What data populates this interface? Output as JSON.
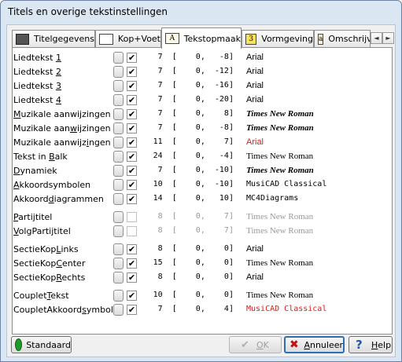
{
  "window": {
    "title": "Titels en overige tekstinstellingen"
  },
  "tabs": [
    {
      "label": "Titelgegevens",
      "icon": "image-icon"
    },
    {
      "label": "Kop+Voet",
      "icon": "page-icon"
    },
    {
      "label": "Tekstopmaak",
      "icon": "font-a-icon",
      "icon_text": "A",
      "active": true
    },
    {
      "label": "Vormgeving",
      "icon": "number-3-icon",
      "icon_text": "3"
    },
    {
      "label": "Omschrijving",
      "icon": "font-a-icon",
      "icon_text": "a"
    }
  ],
  "tab_scroll": {
    "left": "◄",
    "right": "►"
  },
  "rows": [
    {
      "pre": "Liedtekst ",
      "u": "1",
      "post": "",
      "checked": true,
      "v1": "7",
      "v2": "0",
      "v3": "-8",
      "font": "Arial",
      "style": "arial"
    },
    {
      "pre": "Liedtekst ",
      "u": "2",
      "post": "",
      "checked": true,
      "v1": "7",
      "v2": "0",
      "v3": "-12",
      "font": "Arial",
      "style": "arial"
    },
    {
      "pre": "Liedtekst ",
      "u": "3",
      "post": "",
      "checked": true,
      "v1": "7",
      "v2": "0",
      "v3": "-16",
      "font": "Arial",
      "style": "arial"
    },
    {
      "pre": "Liedtekst ",
      "u": "4",
      "post": "",
      "checked": true,
      "v1": "7",
      "v2": "0",
      "v3": "-20",
      "font": "Arial",
      "style": "arial"
    },
    {
      "pre": "",
      "u": "M",
      "post": "uzikale aanwijzingen 1",
      "checked": true,
      "v1": "7",
      "v2": "0",
      "v3": "8",
      "font": "Times New Roman",
      "style": "tnr-bi"
    },
    {
      "pre": "Muzikale aan",
      "u": "w",
      "post": "ijzingen 2",
      "checked": true,
      "v1": "7",
      "v2": "0",
      "v3": "-8",
      "font": "Times New Roman",
      "style": "tnr-bi"
    },
    {
      "pre": "Muzikale aanwijz",
      "u": "i",
      "post": "ngen 3",
      "checked": true,
      "v1": "11",
      "v2": "0",
      "v3": "7",
      "font": "Arial",
      "style": "arial-red"
    },
    {
      "pre": "Tekst in ",
      "u": "B",
      "post": "alk",
      "checked": true,
      "v1": "24",
      "v2": "0",
      "v3": "-4",
      "font": "Times New Roman",
      "style": "tnr"
    },
    {
      "pre": "",
      "u": "D",
      "post": "ynamiek",
      "checked": true,
      "v1": "7",
      "v2": "0",
      "v3": "-10",
      "font": "Times New Roman",
      "style": "tnr-bi"
    },
    {
      "pre": "",
      "u": "A",
      "post": "kkoordsymbolen",
      "checked": true,
      "v1": "10",
      "v2": "0",
      "v3": "-10",
      "font": "MusiCAD Classical",
      "style": "mono"
    },
    {
      "pre": "Akkoord",
      "u": "d",
      "post": "iagrammen",
      "checked": true,
      "v1": "14",
      "v2": "0",
      "v3": "10",
      "font": "MC4Diagrams",
      "style": "mono"
    },
    {
      "pre": "",
      "u": "P",
      "post": "artijtitel",
      "checked": false,
      "v1": "8",
      "v2": "0",
      "v3": "7",
      "font": "Times New Roman",
      "style": "tnr-grey",
      "gap": true
    },
    {
      "pre": "",
      "u": "V",
      "post": "olgPartijtitel",
      "checked": false,
      "v1": "8",
      "v2": "0",
      "v3": "7",
      "font": "Times New Roman",
      "style": "tnr-grey"
    },
    {
      "pre": "SectieKop",
      "u": "L",
      "post": "inks",
      "checked": true,
      "v1": "8",
      "v2": "0",
      "v3": "0",
      "font": "Arial",
      "style": "arial",
      "gap": true
    },
    {
      "pre": "SectieKop",
      "u": "C",
      "post": "enter",
      "checked": true,
      "v1": "15",
      "v2": "0",
      "v3": "0",
      "font": "Times New Roman",
      "style": "tnr"
    },
    {
      "pre": "SectieKop",
      "u": "R",
      "post": "echts",
      "checked": true,
      "v1": "8",
      "v2": "0",
      "v3": "0",
      "font": "Arial",
      "style": "arial"
    },
    {
      "pre": "Couplet",
      "u": "T",
      "post": "ekst",
      "checked": true,
      "v1": "10",
      "v2": "0",
      "v3": "0",
      "font": "Times New Roman",
      "style": "tnr",
      "gap": true
    },
    {
      "pre": "CoupletAkkoord",
      "u": "s",
      "post": "ymbolen",
      "checked": true,
      "v1": "7",
      "v2": "0",
      "v3": "4",
      "font": "MusiCAD Classical",
      "style": "mono-red"
    }
  ],
  "buttons": {
    "standaard": "Standaard",
    "ok_u": "O",
    "ok_rest": "K",
    "annuleer_u": "A",
    "annuleer_rest": "nnuleer",
    "help_u": "H",
    "help_rest": "elp"
  },
  "colors": {
    "accent_red": "#e01818",
    "standaard_green": "#1f9a2c",
    "default_focus": "#2d6fb3"
  }
}
